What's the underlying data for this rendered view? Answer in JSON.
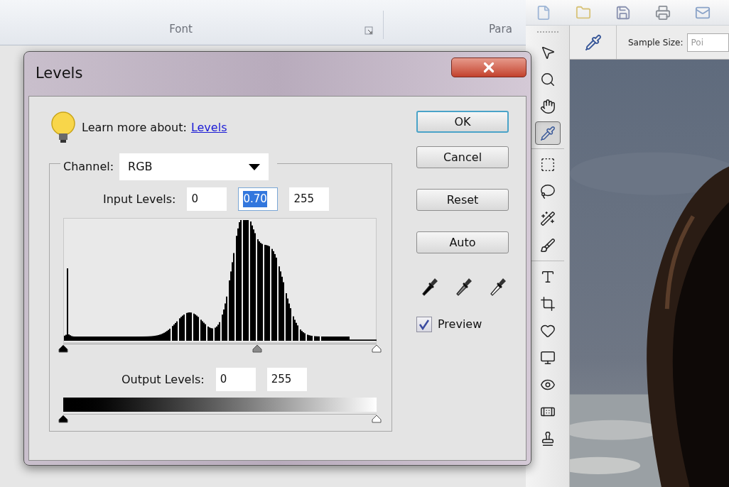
{
  "ribbon": {
    "groups": [
      {
        "label": "Font",
        "launcher": true
      },
      {
        "label": "Para",
        "launcher": false
      }
    ]
  },
  "photo_editor": {
    "options_bar": {
      "sample_size_label": "Sample Size:",
      "sample_size_value": "Poi"
    },
    "tools": [
      {
        "kind": "move",
        "selected": false
      },
      {
        "kind": "zoom",
        "selected": false
      },
      {
        "kind": "hand",
        "selected": false
      },
      {
        "kind": "eyedropper",
        "selected": true
      },
      {
        "kind": "marquee",
        "selected": false
      },
      {
        "kind": "lasso",
        "selected": false
      },
      {
        "kind": "wand",
        "selected": false
      },
      {
        "kind": "brush",
        "selected": false
      },
      {
        "kind": "type",
        "selected": false
      },
      {
        "kind": "crop",
        "selected": false
      },
      {
        "kind": "heart",
        "selected": false
      },
      {
        "kind": "screen",
        "selected": false
      },
      {
        "kind": "eye",
        "selected": false
      },
      {
        "kind": "bandage",
        "selected": false
      },
      {
        "kind": "stamp",
        "selected": false
      }
    ]
  },
  "dialog": {
    "title": "Levels",
    "help_text": "Learn more about:",
    "help_link": "Levels",
    "channel_label": "Channel:",
    "channel": "RGB",
    "input_label": "Input Levels:",
    "input_values": [
      {
        "value": "0",
        "selected": false
      },
      {
        "value": "0.70",
        "selected": true
      },
      {
        "value": "255",
        "selected": false
      }
    ],
    "input_sliders": [
      {
        "kind": "black",
        "level": 0
      },
      {
        "kind": "gray",
        "level": 0.62
      },
      {
        "kind": "white",
        "level": 1
      }
    ],
    "output_label": "Output Levels:",
    "output_values": [
      {
        "value": "0"
      },
      {
        "value": "255"
      }
    ],
    "output_sliders": [
      {
        "kind": "black",
        "level": 0
      },
      {
        "kind": "white",
        "level": 1
      }
    ],
    "buttons": [
      {
        "label": "OK",
        "default": true
      },
      {
        "label": "Cancel",
        "default": false
      },
      {
        "label": "Reset",
        "default": false
      },
      {
        "label": "Auto",
        "default": false
      }
    ],
    "eyedroppers": [
      {
        "kind": "black"
      },
      {
        "kind": "gray"
      },
      {
        "kind": "white"
      }
    ],
    "preview": {
      "label": "Preview",
      "checked": true
    }
  }
}
